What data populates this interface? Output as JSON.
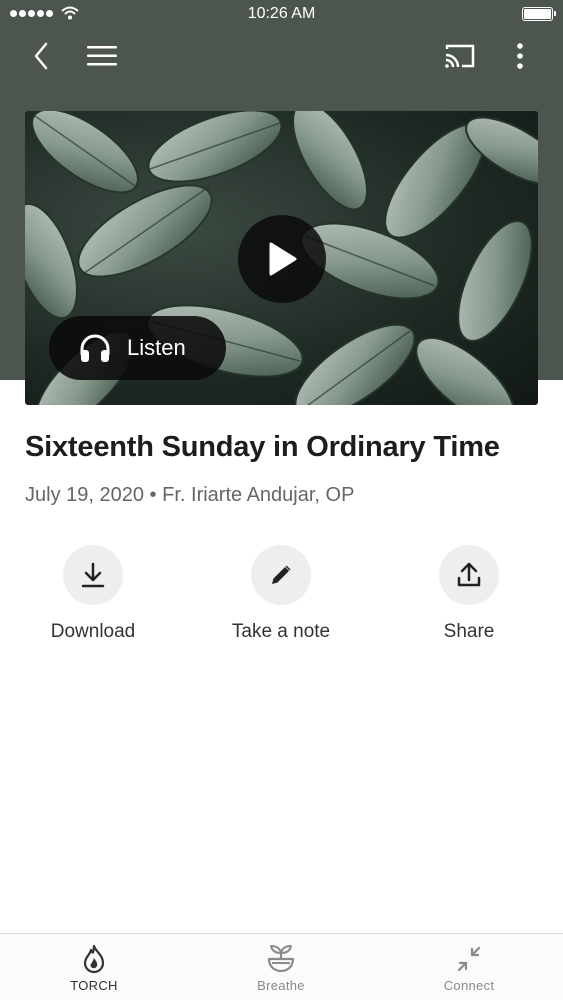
{
  "status_bar": {
    "time": "10:26 AM"
  },
  "episode": {
    "title": "Sixteenth Sunday in Ordinary Time",
    "date": "July 19, 2020",
    "separator": "•",
    "author": "Fr. Iriarte Andujar, OP"
  },
  "media": {
    "listen_label": "Listen"
  },
  "actions": [
    {
      "label": "Download",
      "icon": "download-icon"
    },
    {
      "label": "Take a note",
      "icon": "pencil-icon"
    },
    {
      "label": "Share",
      "icon": "share-icon"
    }
  ],
  "tab_bar": {
    "tabs": [
      {
        "label": "TORCH",
        "icon": "flame-icon",
        "active": true
      },
      {
        "label": "Breathe",
        "icon": "plant-bowl-icon",
        "active": false
      },
      {
        "label": "Connect",
        "icon": "arrows-in-icon",
        "active": false
      }
    ]
  },
  "colors": {
    "header_background": "#4d564e",
    "active_tab": "#333333",
    "inactive_tab": "#8a8a8a"
  }
}
